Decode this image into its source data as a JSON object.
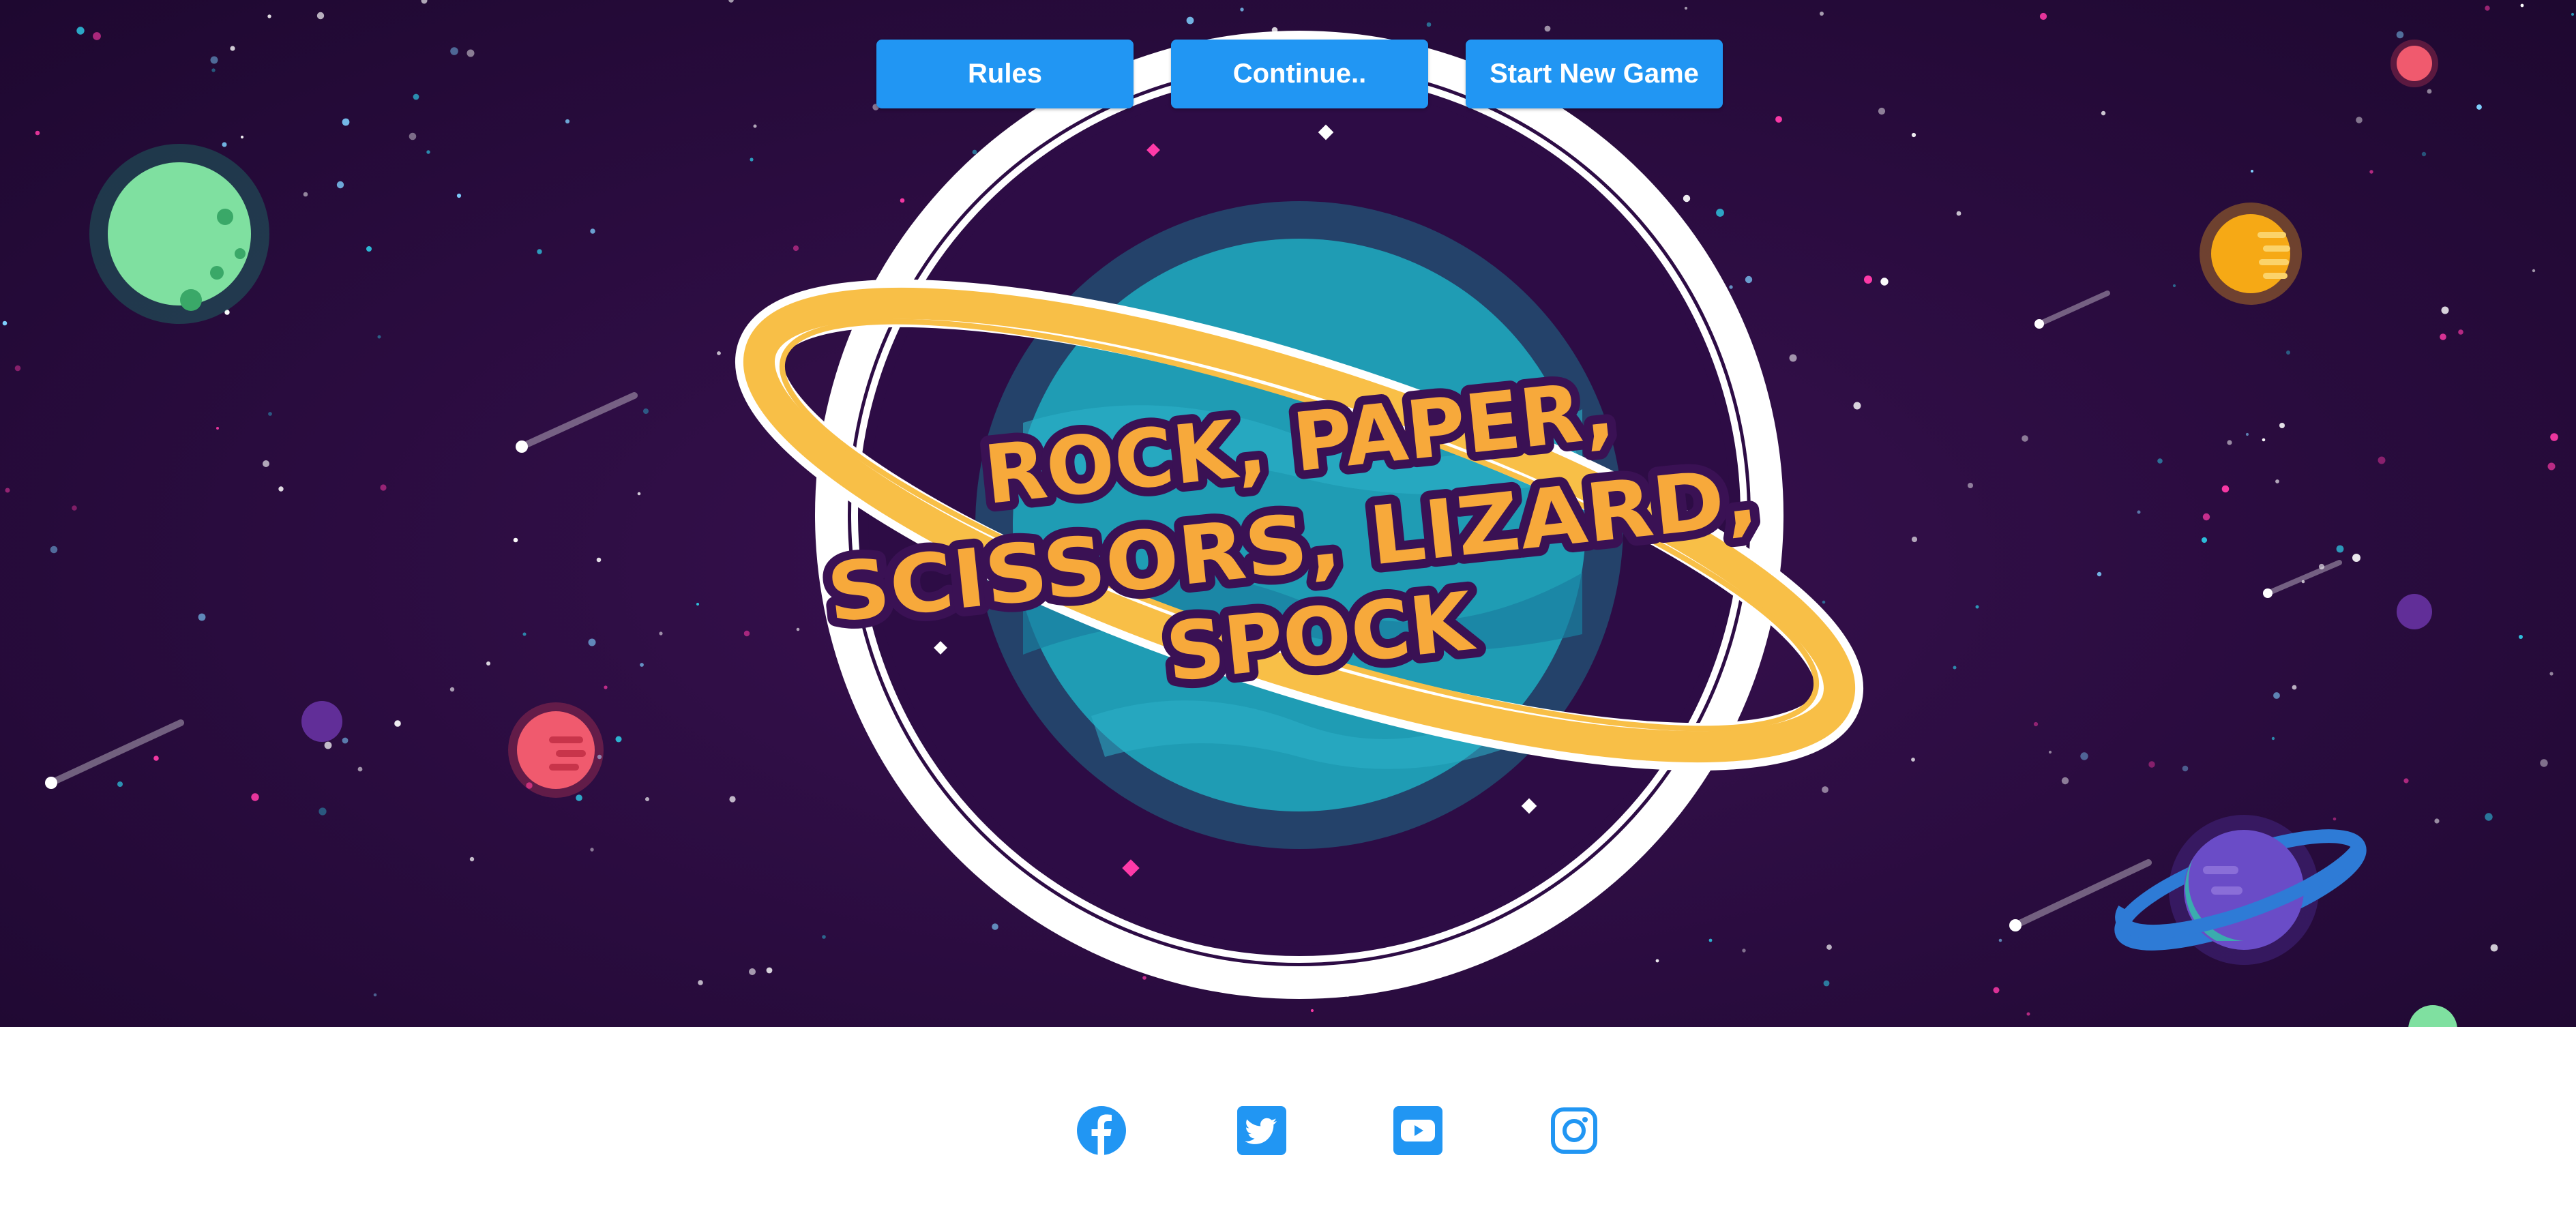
{
  "game": {
    "title_lines": [
      "ROCK, PAPER,",
      "SCISSORS, LIZARD,",
      "SPOCK"
    ]
  },
  "nav": {
    "rules_label": "Rules",
    "continue_label": "Continue..",
    "new_game_label": "Start New Game"
  },
  "social": [
    {
      "name": "facebook-icon"
    },
    {
      "name": "twitter-icon"
    },
    {
      "name": "youtube-icon"
    },
    {
      "name": "instagram-icon"
    }
  ],
  "colors": {
    "button": "#2196f3",
    "title_fill": "#f7a93b",
    "title_stroke": "#3a1154",
    "ring": "#f8bf47",
    "planet": "#1f9cb4",
    "space": "#2a0c3f"
  }
}
